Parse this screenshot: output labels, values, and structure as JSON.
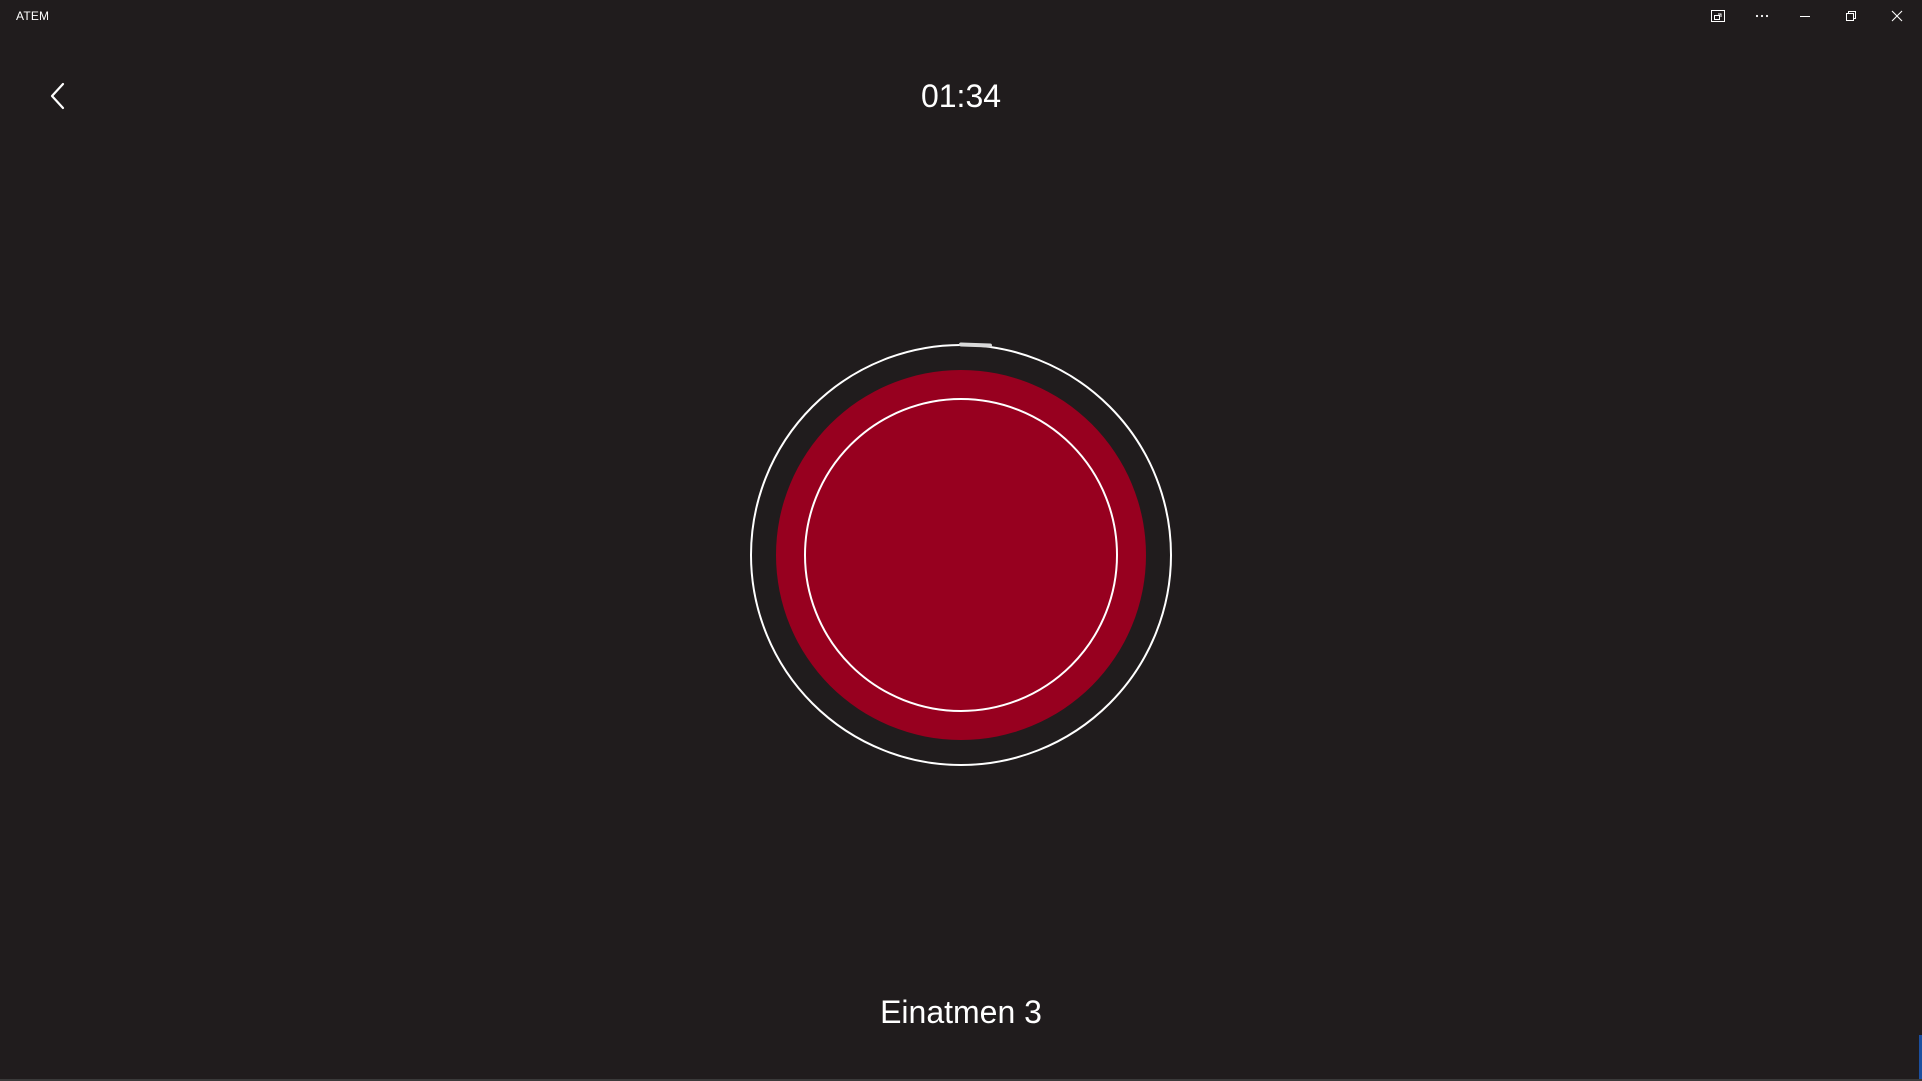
{
  "window": {
    "title": "ATEM",
    "controls": {
      "compact_overlay": "compact-overlay-icon",
      "more": "more-icon",
      "minimize": "minimize-icon",
      "maximize": "restore-icon",
      "close": "close-icon"
    }
  },
  "nav": {
    "back_icon": "chevron-left-icon"
  },
  "session": {
    "timer": "01:34",
    "phase_label": "Einatmen 3"
  },
  "colors": {
    "background": "#201c1d",
    "circle_fill": "#97001f",
    "ring": "#ffffff"
  }
}
